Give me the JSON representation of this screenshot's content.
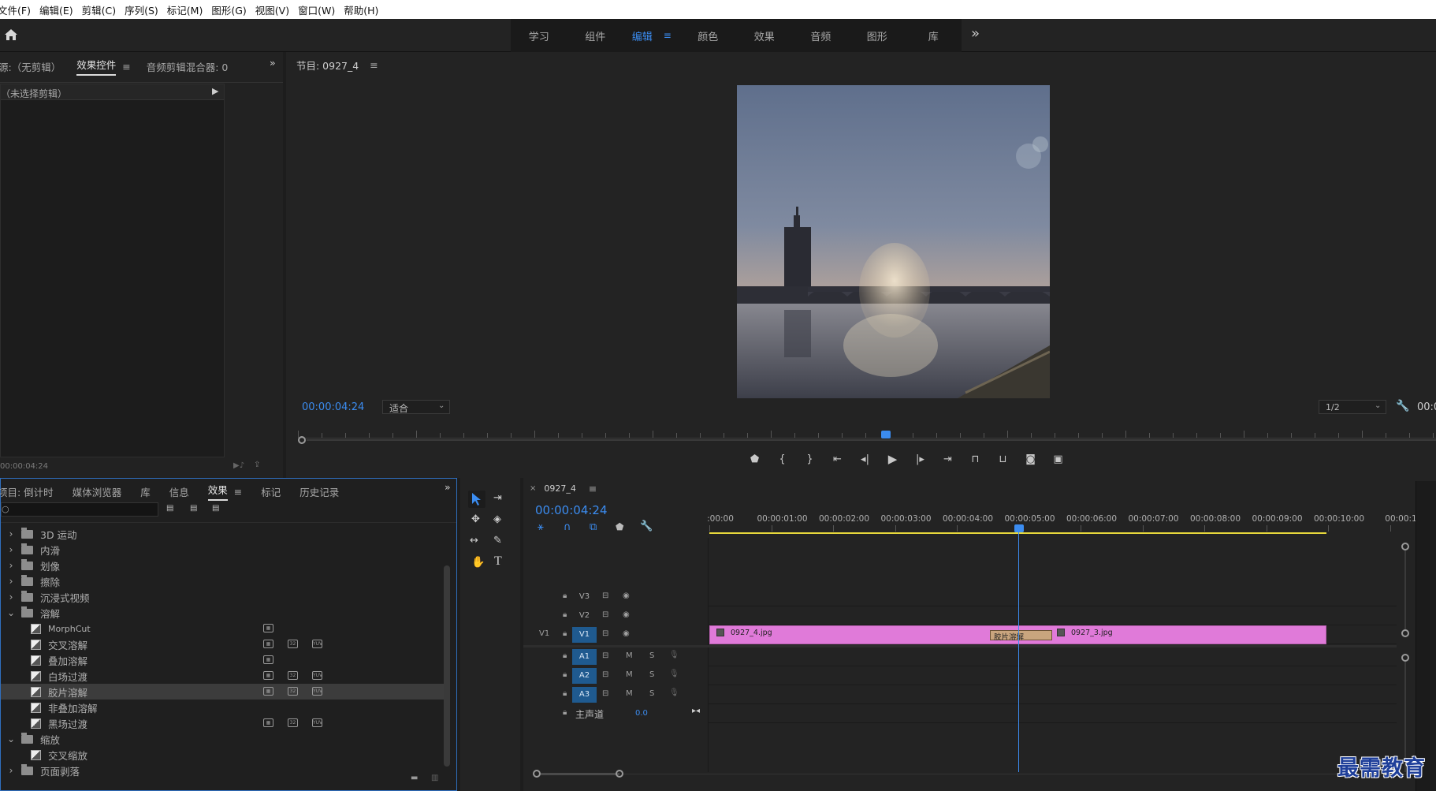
{
  "menu": [
    "文件(F)",
    "编辑(E)",
    "剪辑(C)",
    "序列(S)",
    "标记(M)",
    "图形(G)",
    "视图(V)",
    "窗口(W)",
    "帮助(H)"
  ],
  "workspaces": {
    "items": [
      "学习",
      "组件",
      "编辑",
      "颜色",
      "效果",
      "音频",
      "图形",
      "库"
    ],
    "active": "编辑",
    "more": "»"
  },
  "source_panel": {
    "tabs": [
      "源:（无剪辑）",
      "效果控件",
      "音频剪辑混合器: 0"
    ],
    "active_tab": "效果控件",
    "no_clip": "（未选择剪辑）",
    "timecode": "00:00:04:24"
  },
  "program_panel": {
    "title": "节目: 0927_4",
    "timecode": "00:00:04:24",
    "fit": "适合",
    "resolution": "1/2",
    "right_timecode": "00:0"
  },
  "project_panel": {
    "tabs": [
      "项目: 倒计时",
      "媒体浏览器",
      "库",
      "信息",
      "效果",
      "标记",
      "历史记录"
    ],
    "active_tab": "效果",
    "search_placeholder": "",
    "tree": [
      {
        "type": "folder",
        "label": "3D 运动",
        "level": 0,
        "expanded": false
      },
      {
        "type": "folder",
        "label": "内滑",
        "level": 0,
        "expanded": false
      },
      {
        "type": "folder",
        "label": "划像",
        "level": 0,
        "expanded": false
      },
      {
        "type": "folder",
        "label": "擦除",
        "level": 0,
        "expanded": false
      },
      {
        "type": "folder",
        "label": "沉浸式视频",
        "level": 0,
        "expanded": false
      },
      {
        "type": "folder",
        "label": "溶解",
        "level": 0,
        "expanded": true
      },
      {
        "type": "effect",
        "label": "MorphCut",
        "level": 1,
        "badges": 1
      },
      {
        "type": "effect",
        "label": "交叉溶解",
        "level": 1,
        "badges": 3
      },
      {
        "type": "effect",
        "label": "叠加溶解",
        "level": 1,
        "badges": 1
      },
      {
        "type": "effect",
        "label": "白场过渡",
        "level": 1,
        "badges": 3
      },
      {
        "type": "effect",
        "label": "胶片溶解",
        "level": 1,
        "badges": 3,
        "selected": true
      },
      {
        "type": "effect",
        "label": "非叠加溶解",
        "level": 1,
        "badges": 0
      },
      {
        "type": "effect",
        "label": "黑场过渡",
        "level": 1,
        "badges": 3
      },
      {
        "type": "folder",
        "label": "缩放",
        "level": 0,
        "expanded": true
      },
      {
        "type": "effect",
        "label": "交叉缩放",
        "level": 1,
        "badges": 0
      },
      {
        "type": "folder",
        "label": "页面剥落",
        "level": 0,
        "expanded": false
      }
    ]
  },
  "timeline": {
    "sequence": "0927_4",
    "timecode": "00:00:04:24",
    "ruler": [
      ":00:00",
      "00:00:01:00",
      "00:00:02:00",
      "00:00:03:00",
      "00:00:04:00",
      "00:00:05:00",
      "00:00:06:00",
      "00:00:07:00",
      "00:00:08:00",
      "00:00:09:00",
      "00:00:10:00",
      "00:00:1"
    ],
    "tracks": {
      "video": [
        {
          "name": "V3",
          "active": false,
          "source": ""
        },
        {
          "name": "V2",
          "active": false,
          "source": ""
        },
        {
          "name": "V1",
          "active": true,
          "source": "V1"
        }
      ],
      "audio": [
        {
          "name": "A1",
          "m": "M",
          "s": "S"
        },
        {
          "name": "A2",
          "m": "M",
          "s": "S"
        },
        {
          "name": "A3",
          "m": "M",
          "s": "S"
        }
      ],
      "master_label": "主声道",
      "master_value": "0.0"
    },
    "clips": [
      {
        "name": "0927_4.jpg",
        "track": "V1"
      },
      {
        "name": "0927_3.jpg",
        "track": "V1"
      }
    ],
    "transition": "胶片溶解"
  },
  "colors": {
    "accent": "#3b8cf0",
    "clip": "#e07ad9",
    "transition": "#c9a57e",
    "work_area": "#e7d83c"
  },
  "watermark": "最需教育"
}
